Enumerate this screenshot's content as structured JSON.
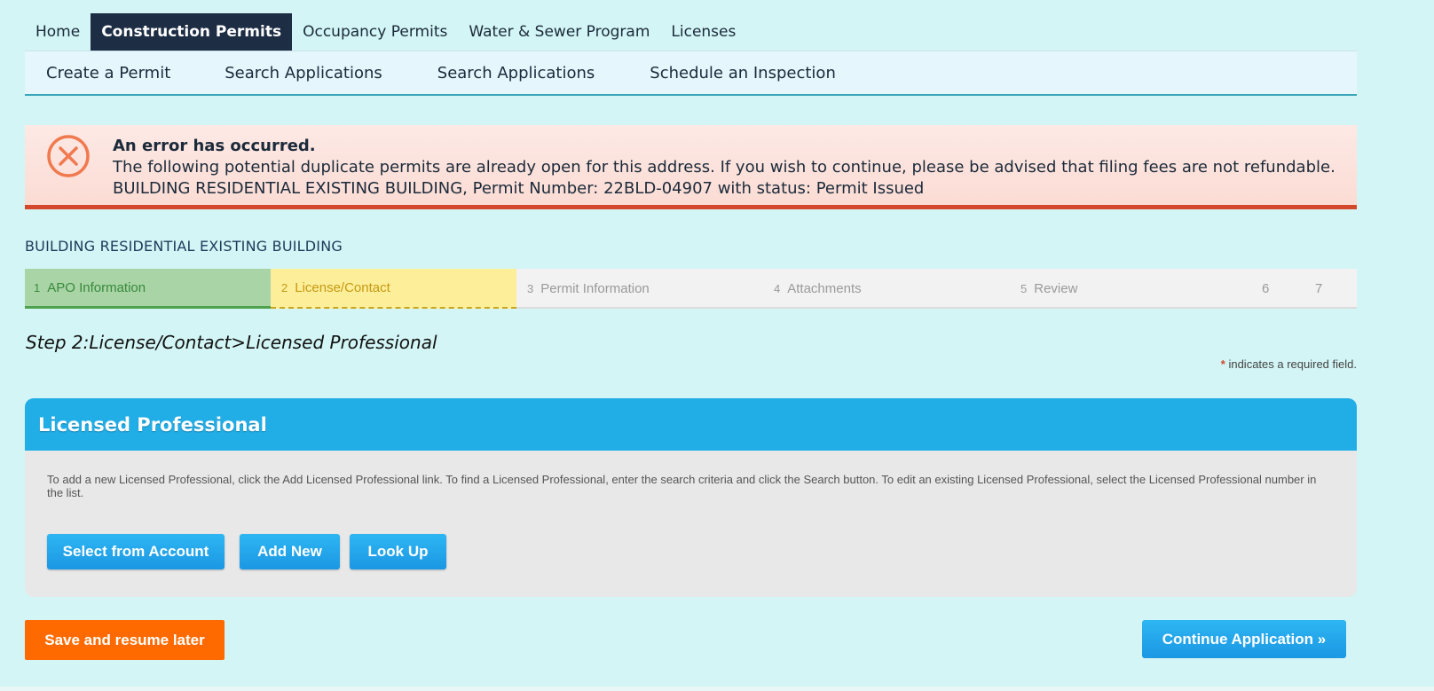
{
  "topnav": {
    "tabs": [
      {
        "label": "Home"
      },
      {
        "label": "Construction Permits",
        "active": true
      },
      {
        "label": "Occupancy Permits"
      },
      {
        "label": "Water & Sewer Program"
      },
      {
        "label": "Licenses"
      }
    ]
  },
  "subnav": {
    "items": [
      {
        "label": "Create a Permit"
      },
      {
        "label": "Search Applications"
      },
      {
        "label": "Search Applications"
      },
      {
        "label": "Schedule an Inspection"
      }
    ]
  },
  "error": {
    "icon": "error-circle-x-icon",
    "title": "An error has occurred.",
    "message": "The following potential duplicate permits are already open for this address. If you wish to continue, please be advised that filing fees are not refundable.",
    "detail": "BUILDING RESIDENTIAL EXISTING BUILDING, Permit Number: 22BLD-04907 with status: Permit Issued",
    "color": "#d3472a"
  },
  "permit_type": "BUILDING RESIDENTIAL EXISTING BUILDING",
  "steps": [
    {
      "num": "1",
      "label": "APO Information",
      "state": "done"
    },
    {
      "num": "2",
      "label": "License/Contact",
      "state": "current"
    },
    {
      "num": "3",
      "label": "Permit Information",
      "state": "pending"
    },
    {
      "num": "4",
      "label": "Attachments",
      "state": "pending"
    },
    {
      "num": "5",
      "label": "Review",
      "state": "pending"
    },
    {
      "num": "6",
      "label": "",
      "state": "pending"
    },
    {
      "num": "7",
      "label": "",
      "state": "pending"
    }
  ],
  "step_heading": "Step 2:License/Contact>Licensed Professional",
  "required_note": {
    "star": "*",
    "text": " indicates a required field."
  },
  "panel": {
    "title": "Licensed Professional",
    "description": "To add a new Licensed Professional, click the Add Licensed Professional link. To find a Licensed Professional, enter the search criteria and click the Search button. To edit an existing Licensed Professional, select the Licensed Professional number in the list.",
    "buttons": {
      "select": "Select from Account",
      "add": "Add New",
      "lookup": "Look Up"
    }
  },
  "actions": {
    "save": "Save and resume later",
    "continue": "Continue Application »"
  },
  "colors": {
    "background": "#d3f5f5",
    "nav_active": "#1d2d44",
    "panel_header": "#21ade6",
    "save_button": "#ff6a00",
    "step_done": "#a8d4a6",
    "step_current": "#fdee9a"
  }
}
